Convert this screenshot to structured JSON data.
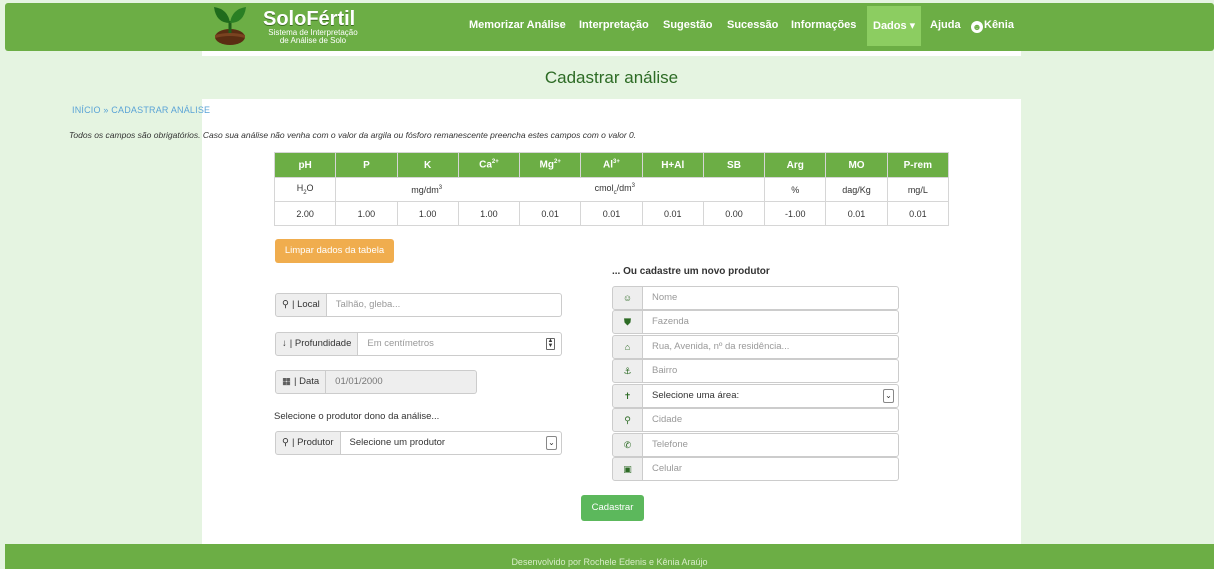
{
  "brand": {
    "title": "SoloFértil",
    "subtitle_1": "Sistema de Interpretação",
    "subtitle_2": "de Análise de Solo"
  },
  "nav": {
    "items": [
      "Memorizar Análise",
      "Interpretação",
      "Sugestão",
      "Sucessão",
      "Informações"
    ],
    "active": "Dados ▾",
    "help": "Ajuda",
    "user": "Kênia"
  },
  "page": {
    "title": "Cadastrar análise",
    "breadcrumb": "INÍCIO » CADASTRAR ANÁLISE",
    "instructions": "Todos os campos são obrigatórios. Caso sua análise não venha com o valor da argila ou fósforo remanescente preencha estes campos com o valor 0."
  },
  "table": {
    "headers": [
      "pH",
      "P",
      "K",
      "Ca",
      "Mg",
      "Al",
      "H+Al",
      "SB",
      "Arg",
      "MO",
      "P-rem"
    ],
    "header_sup": [
      "",
      "",
      "",
      "2+",
      "2+",
      "3+",
      "",
      "",
      "",
      "",
      ""
    ],
    "units": {
      "ph": "H",
      "ph_sub": "2",
      "ph_tail": "O",
      "mg": "mg/dm",
      "mg_sup": "3",
      "cmol": "cmol",
      "cmol_sub": "c",
      "cmol_tail": "/dm",
      "cmol_sup": "3",
      "arg": "%",
      "mo": "dag/Kg",
      "prem": "mg/L"
    },
    "values": [
      "2.00",
      "1.00",
      "1.00",
      "1.00",
      "0.01",
      "0.01",
      "0.01",
      "0.00",
      "-1.00",
      "0.01",
      "0.01"
    ]
  },
  "form": {
    "clear_button": "Limpar dados da tabela",
    "local_label": "| Local",
    "local_placeholder": "Talhão, gleba...",
    "depth_label": "| Profundidade",
    "depth_placeholder": "Em centímetros",
    "date_label": "| Data",
    "date_value": "01/01/2000",
    "producer_prompt": "Selecione o produtor dono da análise...",
    "producer_label": "| Produtor",
    "producer_value": "Selecione um produtor",
    "submit": "Cadastrar"
  },
  "new_producer": {
    "title": "... Ou cadastre um novo produtor",
    "fields": [
      {
        "icon": "smile-icon",
        "glyph": "☺",
        "placeholder": "Nome"
      },
      {
        "icon": "shield-icon",
        "glyph": "⛊",
        "placeholder": "Fazenda"
      },
      {
        "icon": "home-icon",
        "glyph": "⌂",
        "placeholder": "Rua, Avenida, nº da residência..."
      },
      {
        "icon": "anchor-icon",
        "glyph": "⚓",
        "placeholder": "Bairro"
      },
      {
        "icon": "signpost-icon",
        "glyph": "✝",
        "placeholder": "Selecione uma área:"
      },
      {
        "icon": "map-marker-icon",
        "glyph": "⚲",
        "placeholder": "Cidade"
      },
      {
        "icon": "phone-icon",
        "glyph": "✆",
        "placeholder": "Telefone"
      },
      {
        "icon": "mobile-icon",
        "glyph": "▣",
        "placeholder": "Celular"
      }
    ]
  },
  "footer": "Desenvolvido por Rochele Edenis e Kênia Araújo",
  "colors": {
    "brand_green": "#6cae45",
    "active_green": "#8ccd61",
    "page_bg": "#e5f4e1",
    "warning": "#f0ad4e",
    "success": "#5cb85c"
  }
}
